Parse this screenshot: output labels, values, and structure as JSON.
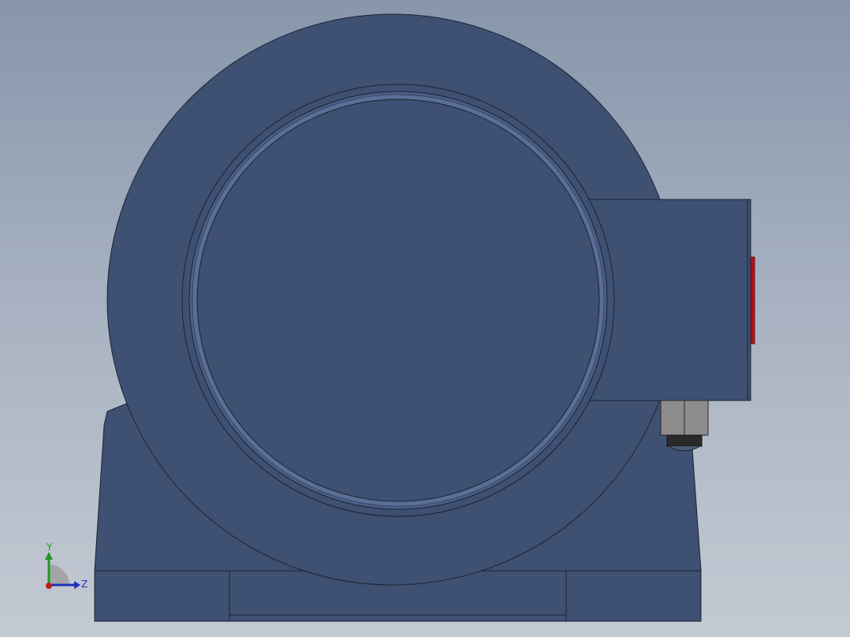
{
  "viewport": {
    "background_top": "#8796ab",
    "background_bottom": "#c4cad3"
  },
  "model": {
    "body_color": "#3e5173",
    "edge_color": "#1a2230",
    "rim_highlight": "#5a6f96",
    "connector_color": "#8c8c8c",
    "connector_dark": "#2a2a2a",
    "plate_color": "#b3121c"
  },
  "triad": {
    "y_label": "Y",
    "z_label": "Z",
    "y_color": "#1f9a1f",
    "z_color": "#1f2fb8",
    "x_color": "#c41a1a"
  }
}
